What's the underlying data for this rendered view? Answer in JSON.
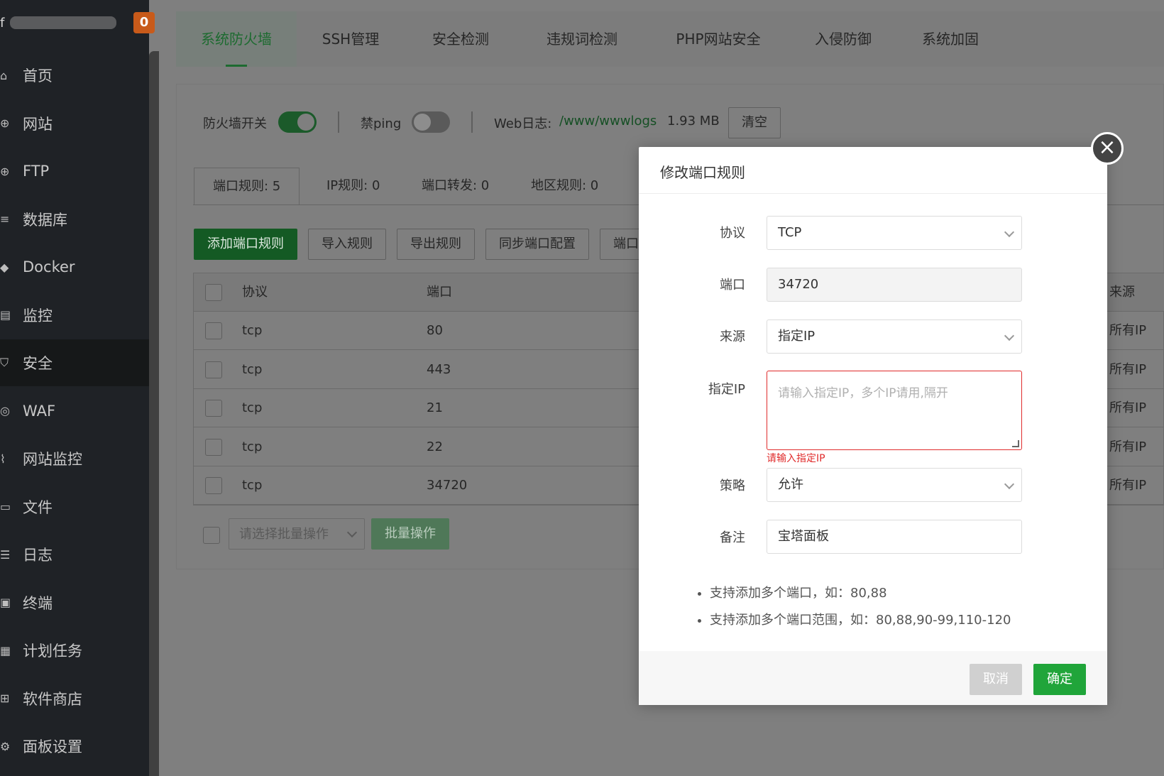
{
  "sidebar": {
    "title_char": "f",
    "badge": "0",
    "items": [
      {
        "label": "首页",
        "icon": "home-icon",
        "glyph": "⌂"
      },
      {
        "label": "网站",
        "icon": "globe-icon",
        "glyph": "⊕"
      },
      {
        "label": "FTP",
        "icon": "globe-icon",
        "glyph": "⊕"
      },
      {
        "label": "数据库",
        "icon": "database-icon",
        "glyph": "≡"
      },
      {
        "label": "Docker",
        "icon": "docker-icon",
        "glyph": "◆"
      },
      {
        "label": "监控",
        "icon": "monitor-icon",
        "glyph": "▤"
      },
      {
        "label": "安全",
        "icon": "shield-icon",
        "glyph": "⛉"
      },
      {
        "label": "WAF",
        "icon": "waf-icon",
        "glyph": "◎"
      },
      {
        "label": "网站监控",
        "icon": "chart-icon",
        "glyph": "⌇"
      },
      {
        "label": "文件",
        "icon": "folder-icon",
        "glyph": "▭"
      },
      {
        "label": "日志",
        "icon": "log-icon",
        "glyph": "☰"
      },
      {
        "label": "终端",
        "icon": "terminal-icon",
        "glyph": "▣"
      },
      {
        "label": "计划任务",
        "icon": "calendar-icon",
        "glyph": "▦"
      },
      {
        "label": "软件商店",
        "icon": "apps-icon",
        "glyph": "⊞"
      },
      {
        "label": "面板设置",
        "icon": "gear-icon",
        "glyph": "⚙"
      }
    ],
    "active_index": 6
  },
  "tabs": [
    "系统防火墙",
    "SSH管理",
    "安全检测",
    "违规词检测",
    "PHP网站安全",
    "入侵防御",
    "系统加固"
  ],
  "controls": {
    "firewall_label": "防火墙开关",
    "firewall_on": true,
    "ping_label": "禁ping",
    "ping_on": false,
    "weblog_label": "Web日志:",
    "weblog_path": "/www/wwwlogs",
    "weblog_size": "1.93 MB",
    "clear_label": "清空"
  },
  "subtabs": [
    "端口规则: 5",
    "IP规则: 0",
    "端口转发: 0",
    "地区规则: 0"
  ],
  "actions": {
    "add": "添加端口规则",
    "import": "导入规则",
    "export": "导出规则",
    "sync": "同步端口配置",
    "more": "端口"
  },
  "table": {
    "headers": {
      "protocol": "协议",
      "port": "端口",
      "source": "来源"
    },
    "rows": [
      {
        "protocol": "tcp",
        "port": "80",
        "source": "所有IP"
      },
      {
        "protocol": "tcp",
        "port": "443",
        "source": "所有IP"
      },
      {
        "protocol": "tcp",
        "port": "21",
        "source": "所有IP"
      },
      {
        "protocol": "tcp",
        "port": "22",
        "source": "所有IP"
      },
      {
        "protocol": "tcp",
        "port": "34720",
        "source": "所有IP"
      }
    ]
  },
  "batch": {
    "placeholder": "请选择批量操作",
    "button": "批量操作"
  },
  "modal": {
    "title": "修改端口规则",
    "protocol_label": "协议",
    "protocol_value": "TCP",
    "port_label": "端口",
    "port_value": "34720",
    "source_label": "来源",
    "source_value": "指定IP",
    "ip_label": "指定IP",
    "ip_placeholder": "请输入指定IP，多个IP请用,隔开",
    "ip_error": "请输入指定IP",
    "policy_label": "策略",
    "policy_value": "允许",
    "remark_label": "备注",
    "remark_value": "宝塔面板",
    "tips": [
      "支持添加多个端口，如：80,88",
      "支持添加多个端口范围，如：80,88,90-99,110-120"
    ],
    "cancel": "取消",
    "confirm": "确定"
  },
  "colors": {
    "brand_green": "#20a53a",
    "error_red": "#e02b2b",
    "sidebar_bg": "#1f2226",
    "badge_orange": "#c85a1a"
  }
}
